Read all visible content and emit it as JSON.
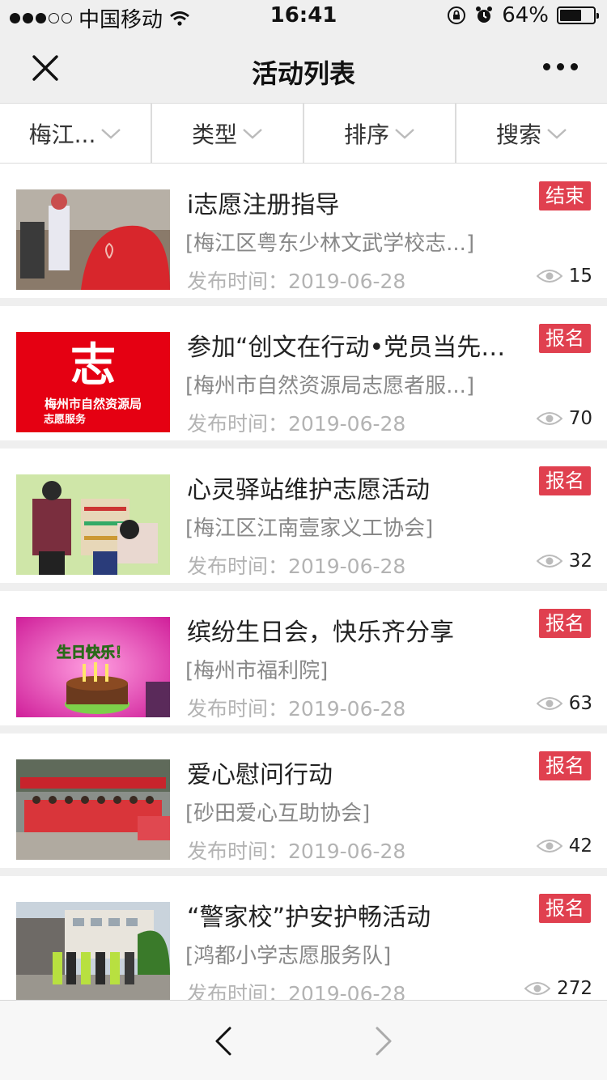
{
  "status_bar": {
    "carrier": "中国移动",
    "time": "16:41",
    "battery": "64%",
    "battery_level": 0.64,
    "signal_bars_filled": 3,
    "signal_bars_total": 5
  },
  "nav": {
    "title": "活动列表",
    "close_icon": "close-icon",
    "more_icon": "more-dots-icon"
  },
  "filters": [
    {
      "label": "梅江..."
    },
    {
      "label": "类型"
    },
    {
      "label": "排序"
    },
    {
      "label": "搜索"
    }
  ],
  "activities": [
    {
      "title": "i志愿注册指导",
      "org": "[梅江区粤东少林文武学校志...]",
      "date_label": "发布时间：",
      "date": "2019-06-28",
      "status": "结束",
      "views": "15"
    },
    {
      "title": "参加“创文在行动•党员当先锋”志愿活动",
      "org": "[梅州市自然资源局志愿者服...]",
      "date_label": "发布时间：",
      "date": "2019-06-28",
      "status": "报名",
      "views": "70",
      "image_text": [
        "志",
        "梅州市自然资源局",
        "志愿服务"
      ]
    },
    {
      "title": "心灵驿站维护志愿活动",
      "org": "[梅江区江南壹家义工协会]",
      "date_label": "发布时间：",
      "date": "2019-06-28",
      "status": "报名",
      "views": "32"
    },
    {
      "title": "缤纷生日会，快乐齐分享",
      "org": "[梅州市福利院]",
      "date_label": "发布时间：",
      "date": "2019-06-28",
      "status": "报名",
      "views": "63",
      "image_text": [
        "生日快乐！"
      ]
    },
    {
      "title": "爱心慰问行动",
      "org": "[砂田爱心互助协会]",
      "date_label": "发布时间：",
      "date": "2019-06-28",
      "status": "报名",
      "views": "42"
    },
    {
      "title": "“警家校”护安护畅活动",
      "org": "[鸿都小学志愿服务队]",
      "date_label": "发布时间：",
      "date": "2019-06-28",
      "status": "报名",
      "views": "272"
    }
  ],
  "bottom_nav": {
    "back_icon": "chevron-left-icon",
    "forward_icon": "chevron-right-icon"
  },
  "colors": {
    "badge": "#e0404f",
    "bar_bg": "#efefef",
    "date_text": "#b3b3b3",
    "org_text": "#888888"
  }
}
